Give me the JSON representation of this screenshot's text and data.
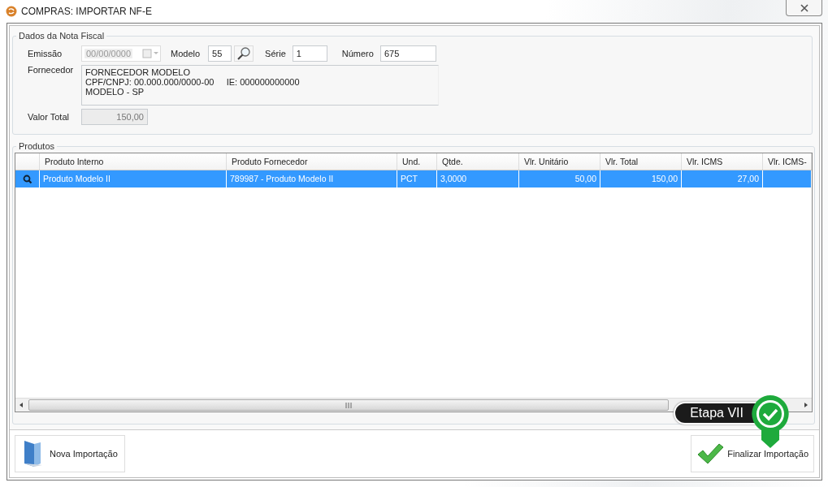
{
  "window": {
    "title": "COMPRAS: IMPORTAR NF-E"
  },
  "nota_fiscal": {
    "legend": "Dados da Nota Fiscal",
    "emissao": {
      "label": "Emissão",
      "value": "00/00/0000",
      "disabled": true
    },
    "modelo": {
      "label": "Modelo",
      "value": "55"
    },
    "serie": {
      "label": "Série",
      "value": "1"
    },
    "numero": {
      "label": "Número",
      "value": "675"
    },
    "fornecedor": {
      "label": "Fornecedor",
      "lines": [
        "FORNECEDOR MODELO",
        "CPF/CNPJ: 00.000.000/0000-00     IE: 000000000000",
        "MODELO - SP"
      ]
    },
    "valor_total": {
      "label": "Valor Total",
      "value": "150,00",
      "disabled": true
    }
  },
  "produtos": {
    "legend": "Produtos",
    "columns": [
      "Produto Interno",
      "Produto Fornecedor",
      "Und.",
      "Qtde.",
      "Vlr. Unitário",
      "Vlr. Total",
      "Vlr. ICMS",
      "Vlr. ICMS-"
    ],
    "rows": [
      {
        "selected": true,
        "cells": [
          "Produto Modelo II",
          "789987 - Produto Modelo II",
          "PCT",
          "3,0000",
          "50,00",
          "150,00",
          "27,00",
          ""
        ]
      }
    ]
  },
  "buttons": [
    {
      "kind": "new",
      "label": "Nova Importação"
    },
    {
      "kind": "finish",
      "label": "Finalizar Importação"
    }
  ],
  "callout": {
    "label": "Etapa VII"
  }
}
